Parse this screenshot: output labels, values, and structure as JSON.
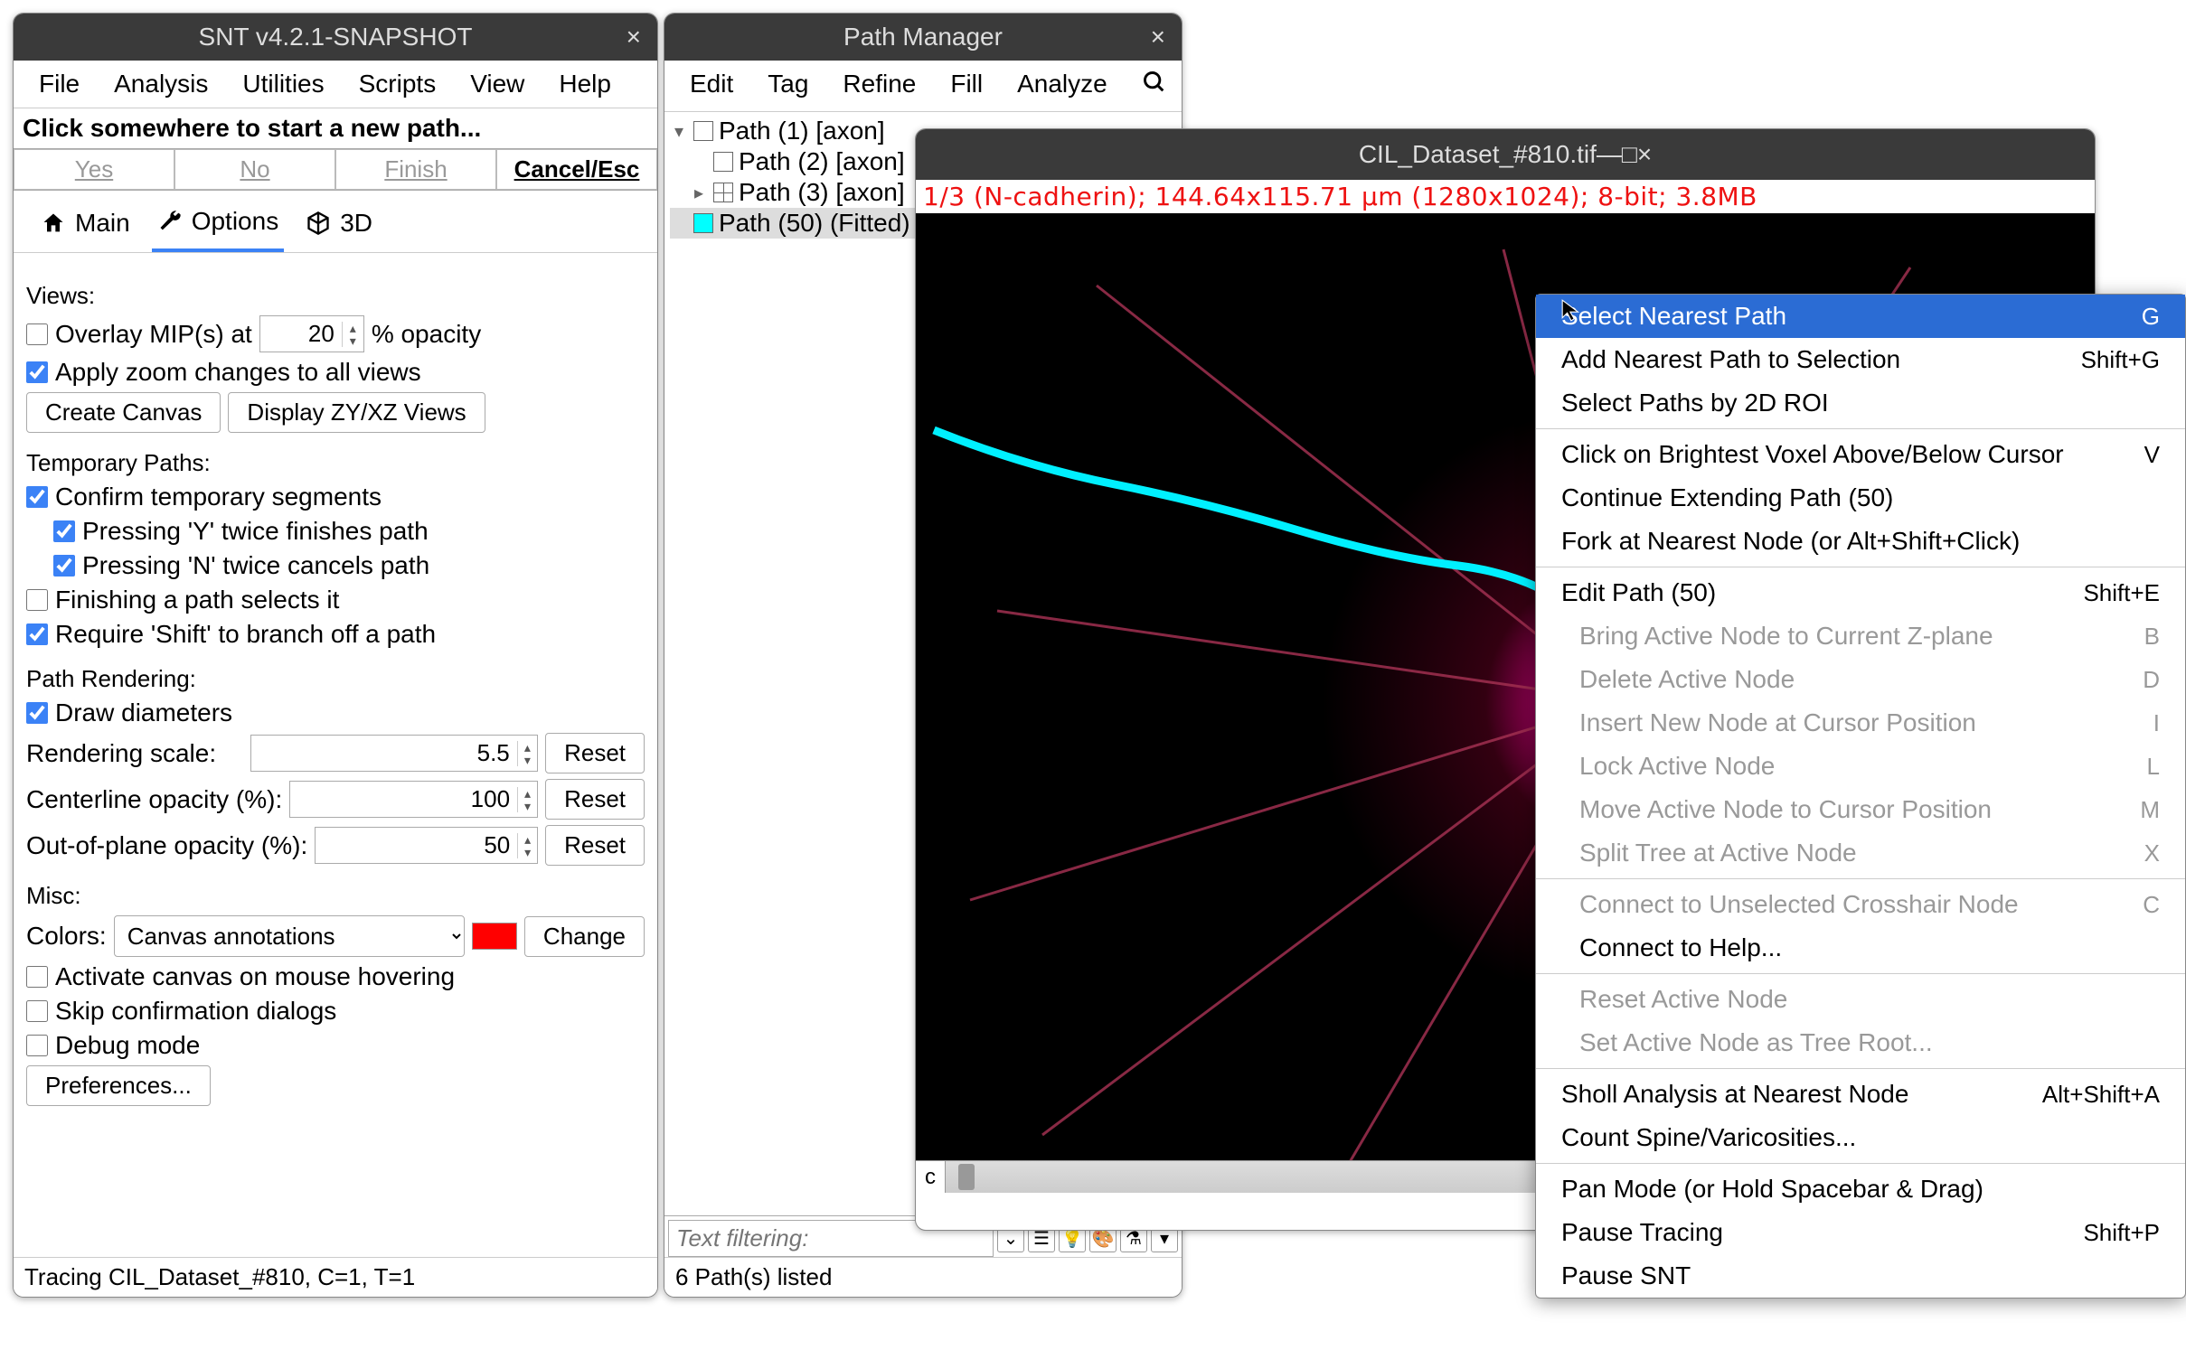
{
  "snt": {
    "title": "SNT v4.2.1-SNAPSHOT",
    "menus": [
      "File",
      "Analysis",
      "Utilities",
      "Scripts",
      "View",
      "Help"
    ],
    "prompt": "Click somewhere to start a new path...",
    "responses": {
      "yes": "Yes",
      "no": "No",
      "finish": "Finish",
      "cancel": "Cancel/Esc"
    },
    "tabs": {
      "main": "Main",
      "options": "Options",
      "threeD": "3D"
    },
    "views": {
      "label": "Views:",
      "overlay_label": "Overlay MIP(s) at",
      "overlay_value": "20",
      "overlay_suffix": "% opacity",
      "apply_zoom": "Apply zoom changes to all views",
      "create_canvas": "Create Canvas",
      "display_views": "Display ZY/XZ Views"
    },
    "temp": {
      "label": "Temporary Paths:",
      "confirm": "Confirm temporary segments",
      "press_y": "Pressing 'Y' twice finishes path",
      "press_n": "Pressing 'N' twice cancels path",
      "finish_selects": "Finishing a path selects it",
      "require_shift": "Require 'Shift' to branch off a path"
    },
    "rendering": {
      "label": "Path Rendering:",
      "draw_diam": "Draw diameters",
      "scale_label": "Rendering scale:",
      "scale_value": "5.5",
      "center_label": "Centerline opacity (%):",
      "center_value": "100",
      "oop_label": "Out-of-plane opacity (%):",
      "oop_value": "50",
      "reset": "Reset"
    },
    "misc": {
      "label": "Misc:",
      "colors_label": "Colors:",
      "colors_value": "Canvas annotations",
      "change": "Change",
      "activate_hover": "Activate canvas on mouse hovering",
      "skip_confirm": "Skip confirmation dialogs",
      "debug": "Debug mode",
      "prefs": "Preferences..."
    },
    "status": "Tracing CIL_Dataset_#810, C=1, T=1"
  },
  "pm": {
    "title": "Path Manager",
    "menus": [
      "Edit",
      "Tag",
      "Refine",
      "Fill",
      "Analyze"
    ],
    "paths": [
      {
        "label": "Path (1) [axon]",
        "swatch": "#ffffff",
        "expander": "▾",
        "indent": 0
      },
      {
        "label": "Path (2) [axon]",
        "swatch": "#ffffff",
        "expander": "",
        "indent": 1
      },
      {
        "label": "Path (3) [axon]",
        "swatch": "#ffffff",
        "expander": "▸",
        "indent": 1,
        "boxed": true
      },
      {
        "label": "Path (50) (Fitted)",
        "swatch": "#00ffff",
        "expander": "",
        "indent": 0,
        "selected": true
      }
    ],
    "filter_placeholder": "Text filtering:",
    "status": "6 Path(s) listed"
  },
  "viewer": {
    "title": "CIL_Dataset_#810.tif",
    "info": "1/3 (N-cadherin); 144.64x115.71 µm (1280x1024); 8-bit; 3.8MB",
    "scroll_label": "c"
  },
  "ctx": {
    "items": [
      {
        "text": "Select Nearest Path",
        "key": "G",
        "state": "selected"
      },
      {
        "text": "Add Nearest Path to Selection",
        "key": "Shift+G"
      },
      {
        "text": "Select Paths by 2D ROI",
        "key": ""
      },
      {
        "sep": true
      },
      {
        "text": "Click on Brightest Voxel Above/Below Cursor",
        "key": "V"
      },
      {
        "text": "Continue Extending Path (50)",
        "key": ""
      },
      {
        "text": "Fork at Nearest Node  (or Alt+Shift+Click)",
        "key": ""
      },
      {
        "sep": true
      },
      {
        "text": "Edit Path (50)",
        "key": "Shift+E"
      },
      {
        "text": "Bring Active Node to Current Z-plane",
        "key": "B",
        "state": "disabled",
        "indent": true
      },
      {
        "text": "Delete Active Node",
        "key": "D",
        "state": "disabled",
        "indent": true
      },
      {
        "text": "Insert New Node at Cursor Position",
        "key": "I",
        "state": "disabled",
        "indent": true
      },
      {
        "text": "Lock Active Node",
        "key": "L",
        "state": "disabled",
        "indent": true
      },
      {
        "text": "Move Active Node to Cursor Position",
        "key": "M",
        "state": "disabled",
        "indent": true
      },
      {
        "text": "Split Tree at Active Node",
        "key": "X",
        "state": "disabled",
        "indent": true
      },
      {
        "sep": true
      },
      {
        "text": "Connect to Unselected Crosshair Node",
        "key": "C",
        "state": "disabled",
        "indent": true
      },
      {
        "text": "Connect to Help...",
        "key": "",
        "indent": true
      },
      {
        "sep": true
      },
      {
        "text": "Reset Active Node",
        "key": "",
        "state": "disabled",
        "indent": true
      },
      {
        "text": "Set Active Node as Tree Root...",
        "key": "",
        "state": "disabled",
        "indent": true
      },
      {
        "sep": true
      },
      {
        "text": "Sholl Analysis at Nearest Node",
        "key": "Alt+Shift+A"
      },
      {
        "text": "Count Spine/Varicosities...",
        "key": ""
      },
      {
        "sep": true
      },
      {
        "text": "Pan Mode  (or Hold Spacebar & Drag)",
        "key": ""
      },
      {
        "text": "Pause Tracing",
        "key": "Shift+P"
      },
      {
        "text": "Pause SNT",
        "key": ""
      }
    ]
  }
}
